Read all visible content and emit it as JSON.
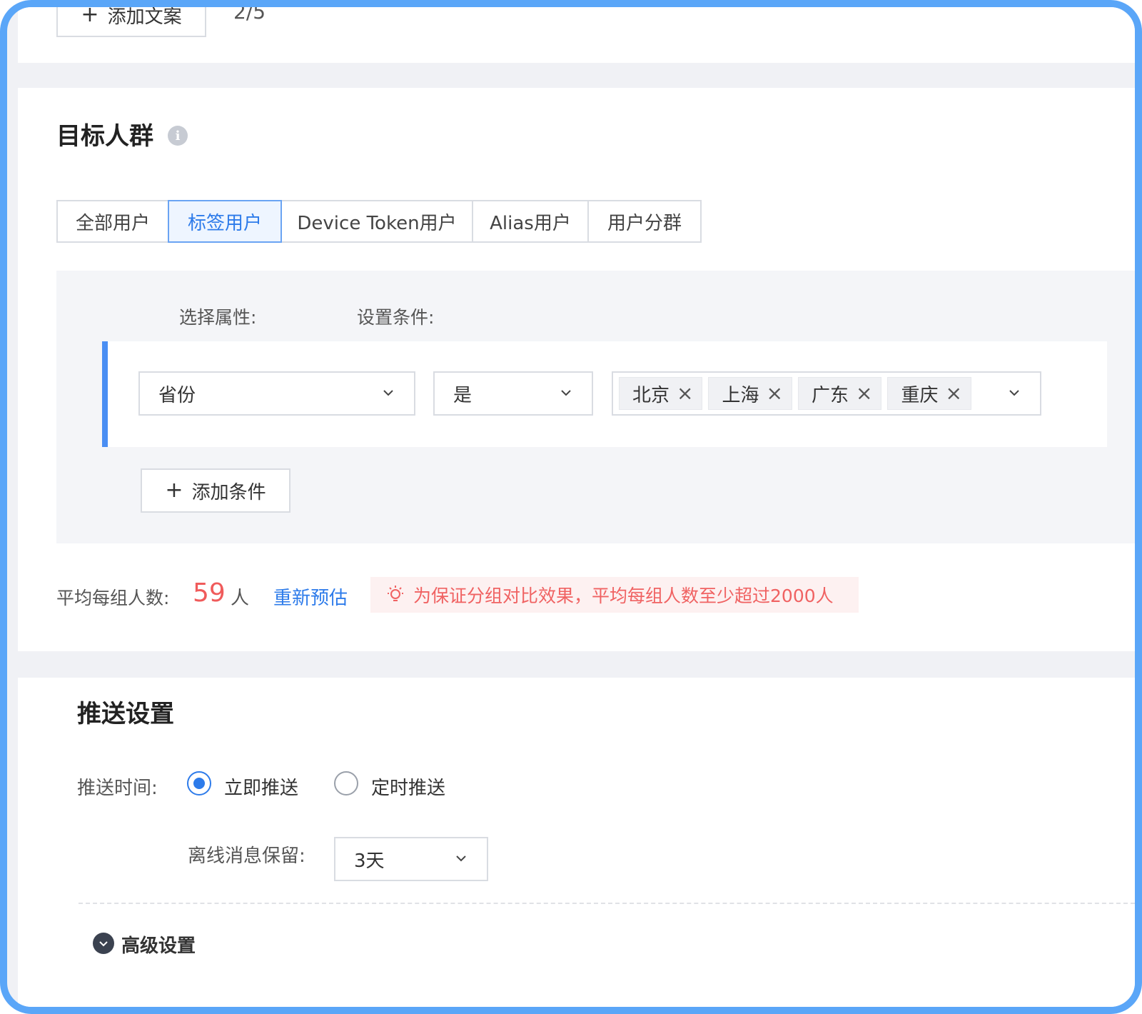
{
  "top": {
    "add_copy_label": "添加文案",
    "copy_count": "2/5"
  },
  "target": {
    "title": "目标人群",
    "tabs": [
      "全部用户",
      "标签用户",
      "Device Token用户",
      "Alias用户",
      "用户分群"
    ],
    "active_tab": "标签用户",
    "select_attr_label": "选择属性:",
    "set_condition_label": "设置条件:",
    "attribute": "省份",
    "operator": "是",
    "values": [
      "北京",
      "上海",
      "广东",
      "重庆"
    ],
    "add_condition_label": "添加条件",
    "avg_label": "平均每组人数:",
    "avg_value": "59",
    "avg_unit": "人",
    "re_estimate": "重新预估",
    "warning": "为保证分组对比效果，平均每组人数至少超过2000人"
  },
  "push": {
    "title": "推送设置",
    "time_label": "推送时间:",
    "options": [
      "立即推送",
      "定时推送"
    ],
    "selected": "立即推送",
    "offline_label": "离线消息保留:",
    "offline_value": "3天",
    "advanced_label": "高级设置"
  },
  "colors": {
    "accent": "#2d7bea",
    "frame": "#5aa6f8",
    "warning_text": "#f06262",
    "warning_bg": "#fdf1f1"
  }
}
